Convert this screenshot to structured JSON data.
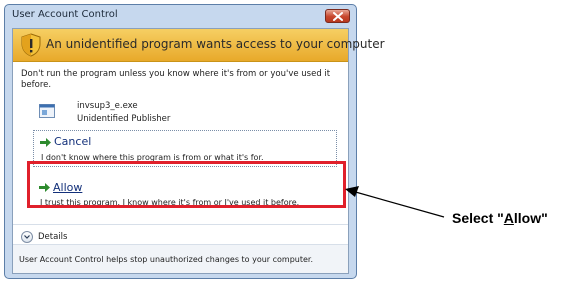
{
  "window": {
    "title": "User Account Control",
    "banner": "An unidentified program wants access to your computer",
    "warning": "Don't run the program unless you know where it's from or you've used it before."
  },
  "program": {
    "name": "invsup3_e.exe",
    "publisher": "Unidentified Publisher"
  },
  "options": {
    "cancel": {
      "title": "Cancel",
      "description": "I don't know where this program is from or what it's for."
    },
    "allow": {
      "title": "Allow",
      "description": "I trust this program. I know where it's from or I've used it before."
    }
  },
  "details": {
    "label": "Details"
  },
  "footer": {
    "text": "User Account Control helps stop unauthorized changes to your computer."
  },
  "callout": {
    "prefix": "Select \"",
    "accent": "A",
    "rest": "llow\""
  },
  "colors": {
    "highlight": "#e0202b",
    "banner": "#f0c04a",
    "arrow": "#2e8b2e",
    "link": "#13307a"
  }
}
